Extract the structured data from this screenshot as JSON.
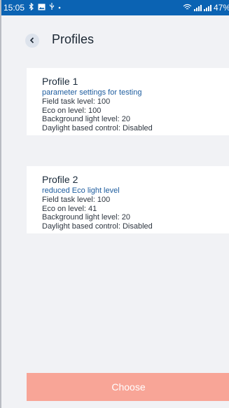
{
  "status_bar": {
    "time": "15:05",
    "battery": "47%",
    "icons": [
      "bluetooth-icon",
      "image-icon",
      "usb-icon",
      "wifi-icon",
      "signal-icon",
      "battery-icon"
    ]
  },
  "header": {
    "title": "Profiles",
    "back_icon": "chevron-left-icon"
  },
  "profiles": [
    {
      "title": "Profile 1",
      "description": "parameter settings for testing",
      "field_task": "Field task level: 100",
      "eco_on": "Eco on level: 100",
      "background": "Background light level: 20",
      "daylight": "Daylight based control: Disabled"
    },
    {
      "title": "Profile 2",
      "description": "reduced Eco light level",
      "field_task": "Field task level: 100",
      "eco_on": "Eco on level: 41",
      "background": "Background light level: 20",
      "daylight": "Daylight based control: Disabled"
    }
  ],
  "footer": {
    "choose_label": "Choose"
  },
  "colors": {
    "status_bar": "#0b63b3",
    "background": "#f1f2f5",
    "accent_text": "#1d5c9e",
    "choose_button": "#f8a597"
  }
}
